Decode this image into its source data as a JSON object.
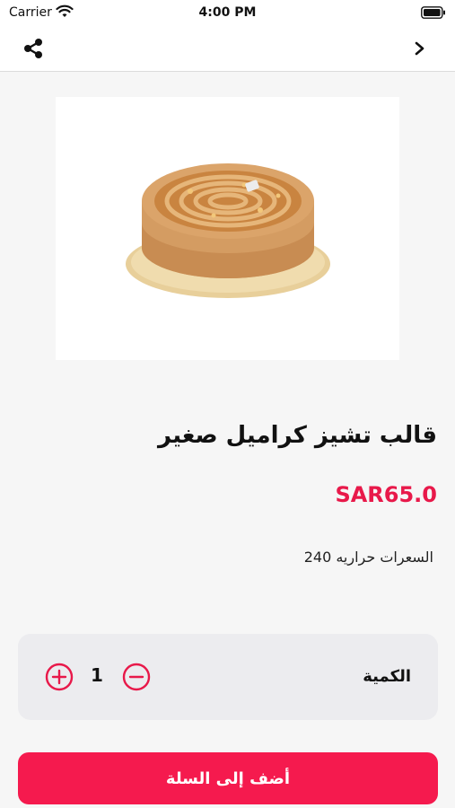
{
  "status_bar": {
    "carrier": "Carrier",
    "time": "4:00 PM"
  },
  "nav": {
    "share_icon": "share-icon",
    "back_icon": "chevron-right-icon"
  },
  "product": {
    "title": "قالب تشيز كراميل صغير",
    "price": "SAR65.0",
    "calories": "السعرات حراريه 240"
  },
  "quantity": {
    "label": "الكمية",
    "value": "1",
    "plus_icon": "plus-circle-icon",
    "minus_icon": "minus-circle-icon"
  },
  "cart": {
    "add_label": "أضف إلى السلة"
  },
  "colors": {
    "accent": "#f51a4e",
    "price": "#e8194a"
  }
}
